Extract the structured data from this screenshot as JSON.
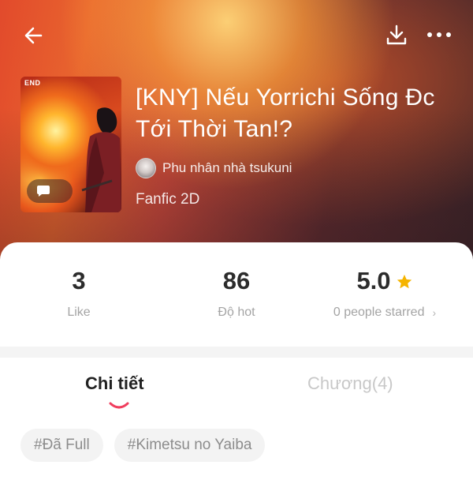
{
  "header": {
    "back_icon": "arrow-left-icon",
    "download_icon": "download-icon",
    "more_icon": "more-horizontal-icon"
  },
  "book": {
    "cover_badge": "END",
    "title": "[KNY] Nếu Yorrichi Sống Đc Tới Thời Tan!?",
    "author": "Phu nhân nhà tsukuni",
    "genre": "Fanfic 2D"
  },
  "stats": {
    "like_value": "3",
    "like_label": "Like",
    "hot_value": "86",
    "hot_label": "Độ hot",
    "rating_value": "5.0",
    "rating_label": "0 people starred",
    "rating_chevron": "›"
  },
  "tabs": {
    "details": "Chi tiết",
    "chapters": "Chương(4)",
    "active": "details"
  },
  "tags": [
    "#Đã Full",
    "#Kimetsu no Yaiba"
  ],
  "colors": {
    "star": "#f5b400",
    "accent": "#f03e5e",
    "text_dark": "#2c2c2c",
    "text_muted": "#a4a4a4"
  }
}
